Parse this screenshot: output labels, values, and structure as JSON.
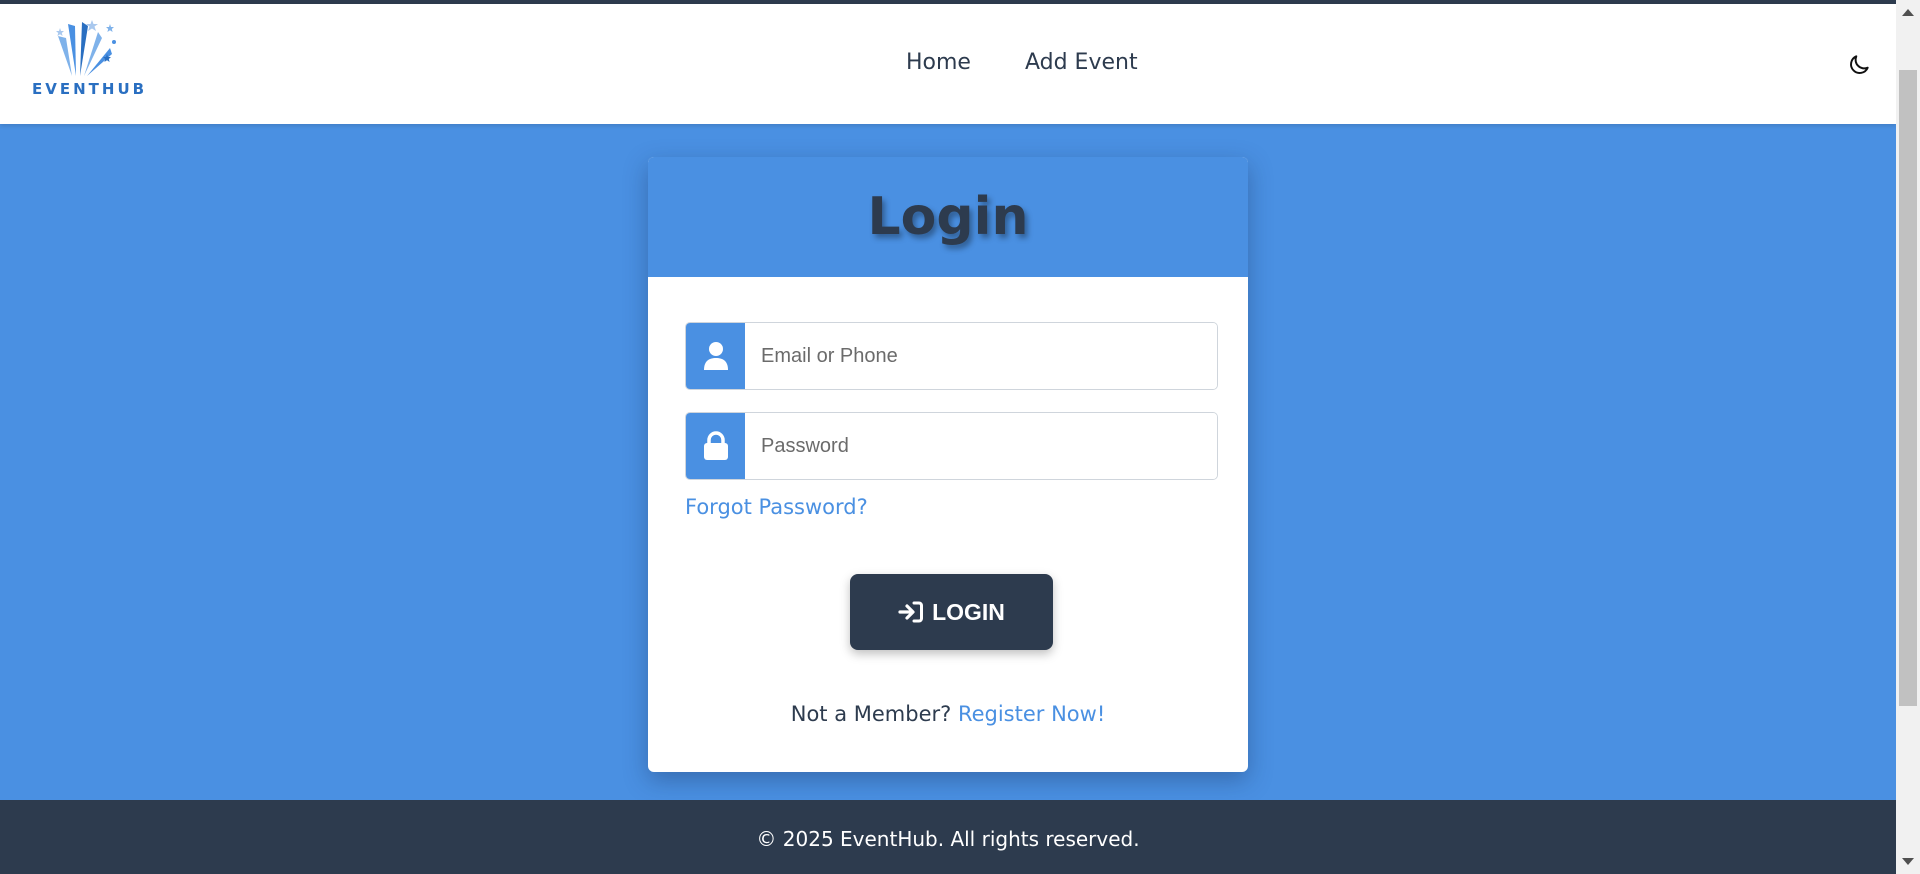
{
  "brand": {
    "name": "EVENTHUB",
    "color": "#2a6fc1"
  },
  "nav": {
    "links": [
      {
        "label": "Home"
      },
      {
        "label": "Add Event"
      }
    ],
    "theme_icon": "moon-icon"
  },
  "login": {
    "title": "Login",
    "email": {
      "placeholder": "Email or Phone",
      "value": "",
      "icon": "user-icon"
    },
    "password": {
      "placeholder": "Password",
      "value": "",
      "icon": "lock-icon"
    },
    "forgot_label": "Forgot Password?",
    "button_label": "LOGIN",
    "button_icon": "sign-in-icon",
    "register_prompt": "Not a Member?",
    "register_link": "Register Now!"
  },
  "footer": {
    "text": "© 2025 EventHub. All rights reserved."
  },
  "colors": {
    "accent": "#4a90e2",
    "dark": "#2d3b4e",
    "background": "#4a90e2"
  }
}
